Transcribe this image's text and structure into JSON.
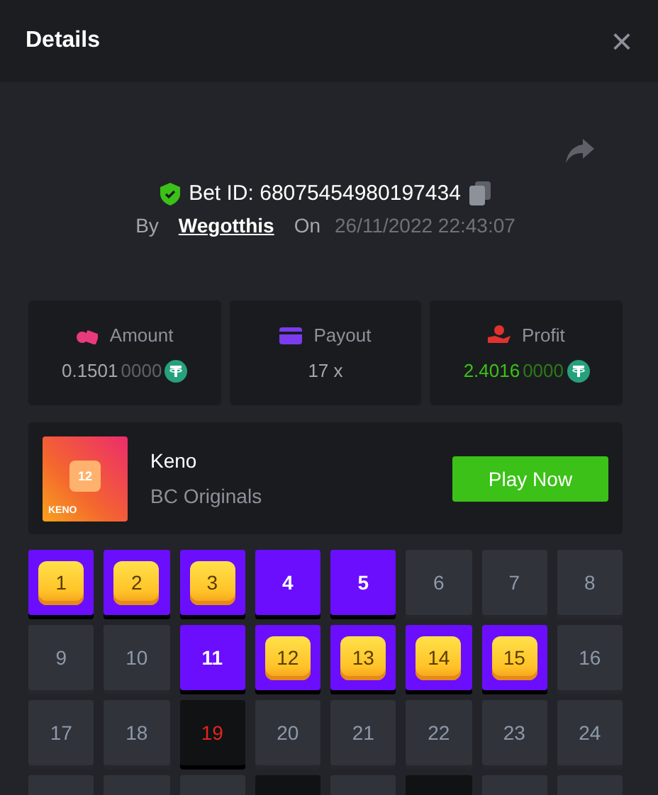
{
  "header": {
    "title": "Details",
    "close": "×"
  },
  "bet": {
    "verified": true,
    "id_label": "Bet ID: 68075454980197434",
    "by_label": "By",
    "user": "Wegotthis",
    "on_label": "On",
    "time": "26/11/2022 22:43:07"
  },
  "stats": [
    {
      "kind": "amount",
      "label": "Amount",
      "value": "0.1501",
      "value_dim": "0000",
      "coin": true,
      "color": "#e93a7d"
    },
    {
      "kind": "payout",
      "label": "Payout",
      "value": "17 x",
      "coin": false,
      "color": "#7b3cf0"
    },
    {
      "kind": "profit",
      "label": "Profit",
      "value": "2.4016",
      "value_dim": "0000",
      "coin": true,
      "color": "#e0332f"
    }
  ],
  "game": {
    "name": "Keno",
    "provider": "BC Originals",
    "thumb_label": "KENO",
    "thumb_number": "12",
    "button": "Play Now"
  },
  "cells": [
    {
      "number": "1",
      "picked": true,
      "drawn": true
    },
    {
      "number": "2",
      "picked": true,
      "drawn": true
    },
    {
      "number": "3",
      "picked": true,
      "drawn": true
    },
    {
      "number": "4",
      "picked": true,
      "drawn": false
    },
    {
      "number": "5",
      "picked": true,
      "drawn": false
    },
    {
      "number": "6",
      "picked": false,
      "drawn": false
    },
    {
      "number": "7",
      "picked": false,
      "drawn": false
    },
    {
      "number": "8",
      "picked": false,
      "drawn": false
    },
    {
      "number": "9",
      "picked": false,
      "drawn": false
    },
    {
      "number": "10",
      "picked": false,
      "drawn": false
    },
    {
      "number": "11",
      "picked": true,
      "drawn": false
    },
    {
      "number": "12",
      "picked": true,
      "drawn": true
    },
    {
      "number": "13",
      "picked": true,
      "drawn": true
    },
    {
      "number": "14",
      "picked": true,
      "drawn": true
    },
    {
      "number": "15",
      "picked": true,
      "drawn": true
    },
    {
      "number": "16",
      "picked": false,
      "drawn": false
    },
    {
      "number": "17",
      "picked": false,
      "drawn": false
    },
    {
      "number": "18",
      "picked": false,
      "drawn": false
    },
    {
      "number": "19",
      "picked": false,
      "drawn": true
    },
    {
      "number": "20",
      "picked": false,
      "drawn": false
    },
    {
      "number": "21",
      "picked": false,
      "drawn": false
    },
    {
      "number": "22",
      "picked": false,
      "drawn": false
    },
    {
      "number": "23",
      "picked": false,
      "drawn": false
    },
    {
      "number": "24",
      "picked": false,
      "drawn": false
    },
    {
      "picked": false,
      "drawn": false
    },
    {
      "picked": false,
      "drawn": false
    },
    {
      "picked": false,
      "drawn": false
    },
    {
      "picked": false,
      "drawn": true
    },
    {
      "picked": false,
      "drawn": false
    },
    {
      "picked": false,
      "drawn": true
    },
    {
      "picked": false,
      "drawn": false
    },
    {
      "picked": false,
      "drawn": false
    }
  ]
}
